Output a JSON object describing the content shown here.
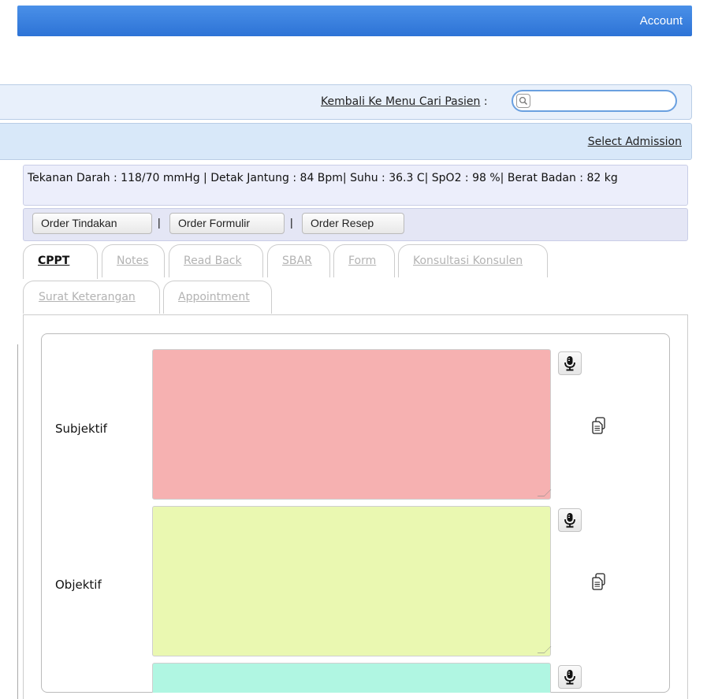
{
  "header": {
    "account_label": "Account"
  },
  "search": {
    "link_label": "Kembali Ke Menu Cari Pasien",
    "separator": " : ",
    "placeholder": "",
    "value": ""
  },
  "admission": {
    "select_label": "Select Admission"
  },
  "vitals": {
    "text": "Tekanan Darah : 118/70 mmHg | Detak Jantung : 84 Bpm| Suhu : 36.3 C| SpO2 : 98 %| Berat Badan : 82 kg"
  },
  "orders": {
    "tindakan_label": "Order Tindakan",
    "formulir_label": "Order Formulir",
    "resep_label": "Order Resep",
    "separator": "|"
  },
  "tabs": [
    {
      "label": "CPPT",
      "active": true
    },
    {
      "label": "Notes"
    },
    {
      "label": "Read Back"
    },
    {
      "label": "SBAR"
    },
    {
      "label": "Form"
    },
    {
      "label": "Konsultasi Konsulen"
    },
    {
      "label": "Surat Keterangan"
    },
    {
      "label": "Appointment"
    }
  ],
  "cppt": {
    "subjektif_label": "Subjektif",
    "objektif_label": "Objektif",
    "subjektif_value": "",
    "objektif_value": "",
    "assessment_value": ""
  },
  "icons": {
    "microphone": "microphone-icon",
    "copy": "copy-icon",
    "search": "search-icon"
  },
  "colors": {
    "header_blue": "#3a80df",
    "subjektif_bg": "#f6b1b1",
    "objektif_bg": "#eaf8b1",
    "assessment_bg": "#b0f6e2"
  }
}
